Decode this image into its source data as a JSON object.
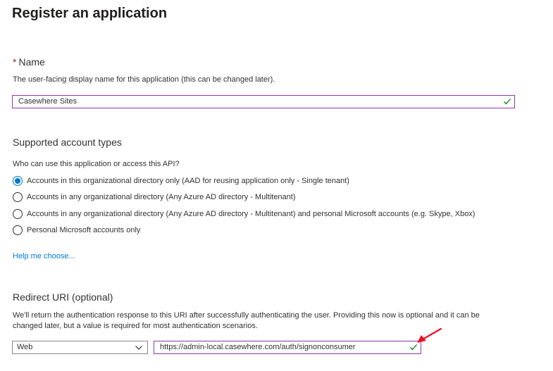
{
  "page": {
    "title": "Register an application"
  },
  "name_section": {
    "required_marker": "*",
    "label": "Name",
    "help": "The user-facing display name for this application (this can be changed later).",
    "value": "Casewhere Sites",
    "valid_icon": "checkmark-icon"
  },
  "account_types": {
    "label": "Supported account types",
    "question": "Who can use this application or access this API?",
    "selected_index": 0,
    "options": [
      "Accounts in this organizational directory only (AAD for reusing application only - Single tenant)",
      "Accounts in any organizational directory (Any Azure AD directory - Multitenant)",
      "Accounts in any organizational directory (Any Azure AD directory - Multitenant) and personal Microsoft accounts (e.g. Skype, Xbox)",
      "Personal Microsoft accounts only"
    ],
    "help_link": "Help me choose..."
  },
  "redirect": {
    "label": "Redirect URI (optional)",
    "description_line1": "We'll return the authentication response to this URI after successfully authenticating the user. Providing this now is optional and it can be",
    "description_line2": "changed later, but a value is required for most authentication scenarios.",
    "platform_value": "Web",
    "uri_value": "https://admin-local.casewhere.com/auth/signonconsumer",
    "valid_icon": "checkmark-icon",
    "annotation_icon": "red-arrow-icon"
  },
  "colors": {
    "accent": "#0078d4",
    "focus_border": "#8a3aa8",
    "valid": "#107c10",
    "required": "#a4262c",
    "annotation_arrow": "#e81123"
  }
}
